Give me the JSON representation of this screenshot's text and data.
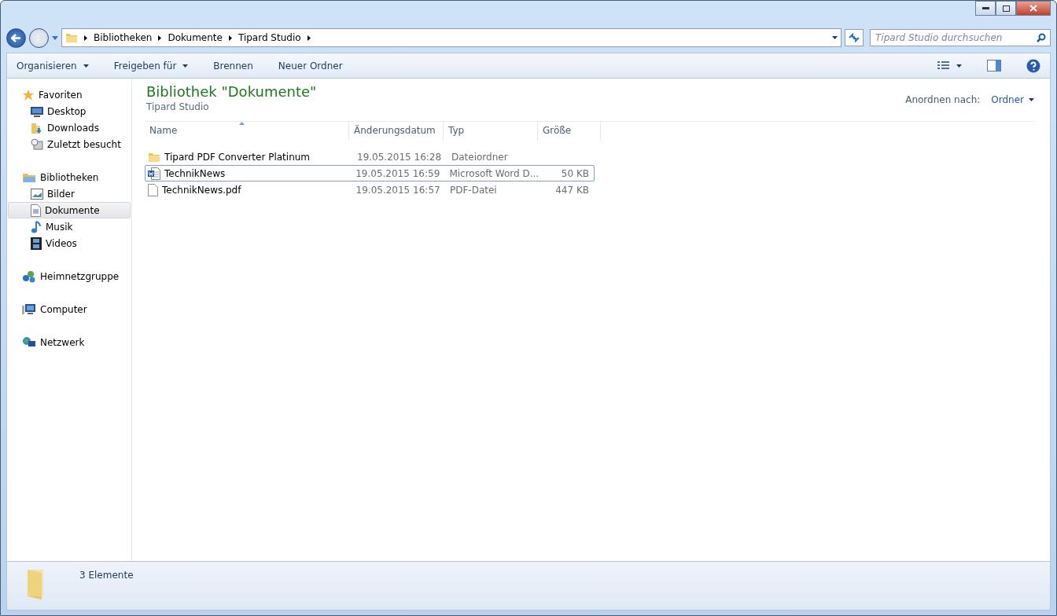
{
  "breadcrumb": [
    "Bibliotheken",
    "Dokumente",
    "Tipard Studio"
  ],
  "search": {
    "placeholder": "Tipard Studio durchsuchen"
  },
  "toolbar": [
    {
      "label": "Organisieren",
      "dropdown": true
    },
    {
      "label": "Freigeben für",
      "dropdown": true
    },
    {
      "label": "Brennen",
      "dropdown": false
    },
    {
      "label": "Neuer Ordner",
      "dropdown": false
    }
  ],
  "sidebar": [
    {
      "label": "Favoriten",
      "kind": "star",
      "selected": false,
      "children": [
        {
          "label": "Desktop",
          "kind": "desktop",
          "selected": false
        },
        {
          "label": "Downloads",
          "kind": "download",
          "selected": false
        },
        {
          "label": "Zuletzt besucht",
          "kind": "recent",
          "selected": false
        }
      ]
    },
    {
      "label": "Bibliotheken",
      "kind": "library",
      "selected": false,
      "children": [
        {
          "label": "Bilder",
          "kind": "pictures",
          "selected": false
        },
        {
          "label": "Dokumente",
          "kind": "document",
          "selected": true
        },
        {
          "label": "Musik",
          "kind": "music",
          "selected": false
        },
        {
          "label": "Videos",
          "kind": "video",
          "selected": false
        }
      ]
    },
    {
      "label": "Heimnetzgruppe",
      "kind": "homegroup",
      "selected": false
    },
    {
      "label": "Computer",
      "kind": "computer",
      "selected": false
    },
    {
      "label": "Netzwerk",
      "kind": "network",
      "selected": false
    }
  ],
  "heading": {
    "title": "Bibliothek \"Dokumente\"",
    "subtitle": "Tipard Studio"
  },
  "arrange": {
    "label": "Anordnen nach:",
    "value": "Ordner"
  },
  "table": {
    "columns": [
      "Name",
      "Änderungsdatum",
      "Typ",
      "Größe"
    ],
    "rows": [
      {
        "kind": "folder",
        "name": "Tipard PDF Converter Platinum",
        "date": "19.05.2015 16:28",
        "type": "Dateiordner",
        "focused": false
      },
      {
        "kind": "word",
        "name": "TechnikNews",
        "date": "19.05.2015 16:59",
        "type": "Microsoft Word D...",
        "size": "50 KB",
        "focused": true
      },
      {
        "kind": "pdf",
        "name": "TechnikNews.pdf",
        "date": "19.05.2015 16:57",
        "type": "PDF-Datei",
        "size": "447 KB",
        "focused": false
      }
    ]
  },
  "status_bar": {
    "text": "3 Elemente"
  }
}
